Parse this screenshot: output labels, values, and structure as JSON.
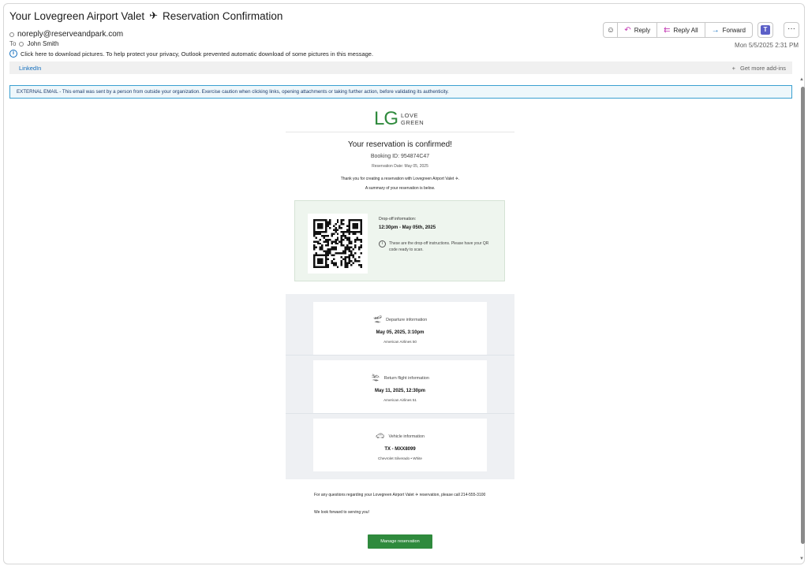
{
  "email": {
    "subject_prefix": "Your Lovegreen Airport Valet",
    "subject_icon": "airplane-icon",
    "subject_suffix": "Reservation Confirmation",
    "from": "noreply@reserveandpark.com",
    "to_label": "To",
    "to": "John Smith",
    "pictures_notice": "Click here to download pictures. To help protect your privacy, Outlook prevented automatic download of some pictures in this message.",
    "date": "Mon 5/5/2025 2:31 PM"
  },
  "toolbar": {
    "reply": "Reply",
    "reply_all": "Reply All",
    "forward": "Forward",
    "more": "···"
  },
  "addins": {
    "linkedin": "LinkedIn",
    "get_more": "Get more add-ins"
  },
  "banner": "EXTERNAL EMAIL - This email was sent by a person from outside your organization. Exercise caution when clicking links, opening attachments or taking further action, before validating its authenticity.",
  "message": {
    "logo_mark": "LG",
    "logo_word1": "LOVE",
    "logo_word2": "GREEN",
    "title": "Your reservation is confirmed!",
    "booking_id": "Booking ID: 954874C47",
    "reservation_date": "Reservation Date: May 05, 2025",
    "thanks_line1": "Thank you for creating a reservation with Lovegreen Airport Valet ✈.",
    "thanks_line2": "A summary of your reservation is below.",
    "dropoff_label": "Drop-off information:",
    "dropoff_time": "12:30pm - May 05th, 2025",
    "dropoff_note": "These are the drop-off instructions. Please have your QR code ready to scan.",
    "cards": [
      {
        "heading": "Departure information",
        "value": "May 05, 2025, 3:10pm",
        "sub": "American Airlines 50",
        "icon": "departure-icon"
      },
      {
        "heading": "Return flight information",
        "value": "May 11, 2025, 12:30pm",
        "sub": "American Airlines 51",
        "icon": "arrival-icon"
      },
      {
        "heading": "Vehicle information",
        "value": "TX - MXX8099",
        "sub": "Chevrolet Silverado • White",
        "icon": "car-icon"
      }
    ],
    "footer_questions": "For any questions regarding your Lovegreen Airport Valet ✈ reservation, please call 214-555-3100",
    "footer_closing": "We look forward to serving you!",
    "manage_button": "Manage reservation"
  },
  "colors": {
    "brand_green": "#2f8a3d",
    "link_blue": "#0f6cbd",
    "reply_purple": "#c239b3",
    "dropoff_bg": "#eef5ee",
    "panel_bg": "#eef0f3"
  }
}
